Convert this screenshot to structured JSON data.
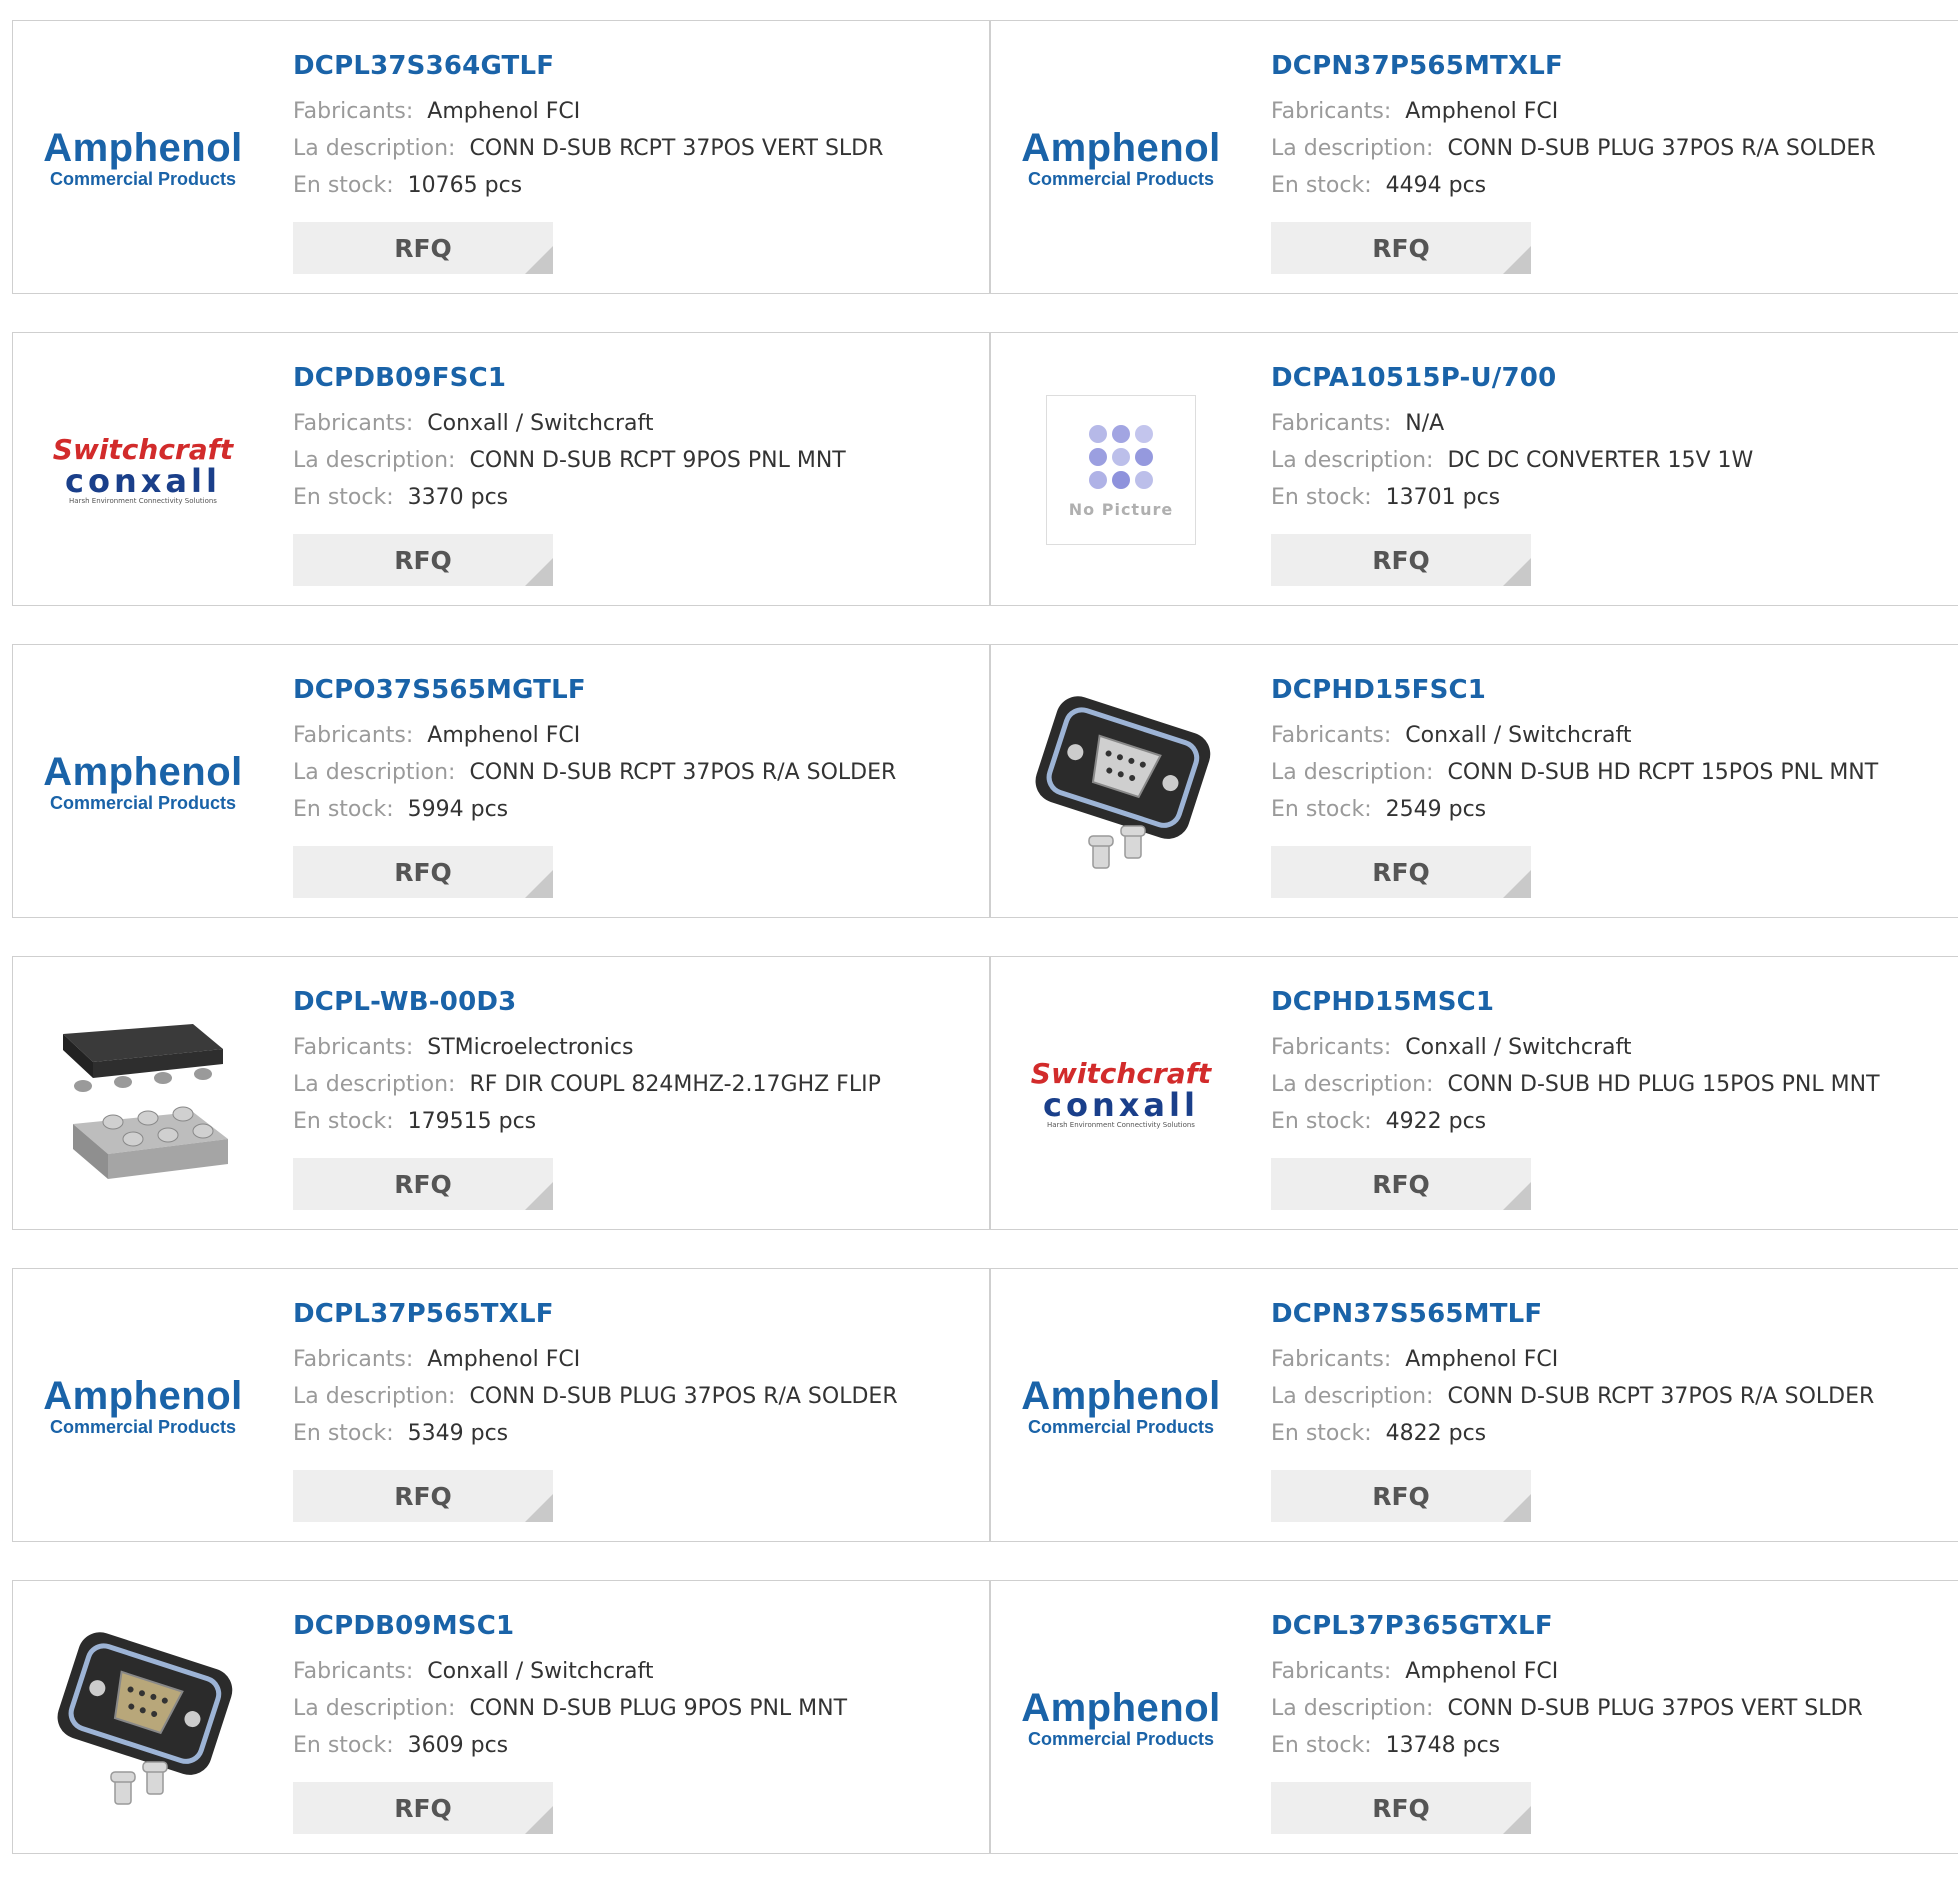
{
  "labels": {
    "manufacturer": "Fabricants:",
    "description": "La description:",
    "stock": "En stock:",
    "rfq": "RFQ"
  },
  "brand_color": "#1a63a8",
  "products": [
    {
      "part": "DCPL37S364GTLF",
      "manufacturer": "Amphenol FCI",
      "description": "CONN D-SUB RCPT 37POS VERT SLDR",
      "stock": "10765 pcs",
      "image": "amphenol-logo"
    },
    {
      "part": "DCPN37P565MTXLF",
      "manufacturer": "Amphenol FCI",
      "description": "CONN D-SUB PLUG 37POS R/A SOLDER",
      "stock": "4494 pcs",
      "image": "amphenol-logo"
    },
    {
      "part": "DCPDB09FSC1",
      "manufacturer": "Conxall / Switchcraft",
      "description": "CONN D-SUB RCPT 9POS PNL MNT",
      "stock": "3370 pcs",
      "image": "switchcraft-logo"
    },
    {
      "part": "DCPA10515P-U/700",
      "manufacturer": "N/A",
      "description": "DC DC CONVERTER 15V 1W",
      "stock": "13701 pcs",
      "image": "no-picture"
    },
    {
      "part": "DCPO37S565MGTLF",
      "manufacturer": "Amphenol FCI",
      "description": "CONN D-SUB RCPT 37POS R/A SOLDER",
      "stock": "5994 pcs",
      "image": "amphenol-logo"
    },
    {
      "part": "DCPHD15FSC1",
      "manufacturer": "Conxall / Switchcraft",
      "description": "CONN D-SUB HD RCPT 15POS PNL MNT",
      "stock": "2549 pcs",
      "image": "dsub-receptacle-photo"
    },
    {
      "part": "DCPL-WB-00D3",
      "manufacturer": "STMicroelectronics",
      "description": "RF DIR COUPL 824MHZ-2.17GHZ FLIP",
      "stock": "179515 pcs",
      "image": "flip-chip-photo"
    },
    {
      "part": "DCPHD15MSC1",
      "manufacturer": "Conxall / Switchcraft",
      "description": "CONN D-SUB HD PLUG 15POS PNL MNT",
      "stock": "4922 pcs",
      "image": "switchcraft-logo"
    },
    {
      "part": "DCPL37P565TXLF",
      "manufacturer": "Amphenol FCI",
      "description": "CONN D-SUB PLUG 37POS R/A SOLDER",
      "stock": "5349 pcs",
      "image": "amphenol-logo"
    },
    {
      "part": "DCPN37S565MTLF",
      "manufacturer": "Amphenol FCI",
      "description": "CONN D-SUB RCPT 37POS R/A SOLDER",
      "stock": "4822 pcs",
      "image": "amphenol-logo"
    },
    {
      "part": "DCPDB09MSC1",
      "manufacturer": "Conxall / Switchcraft",
      "description": "CONN D-SUB PLUG 9POS PNL MNT",
      "stock": "3609 pcs",
      "image": "dsub-plug-photo"
    },
    {
      "part": "DCPL37P365GTXLF",
      "manufacturer": "Amphenol FCI",
      "description": "CONN D-SUB PLUG 37POS VERT SLDR",
      "stock": "13748 pcs",
      "image": "amphenol-logo"
    }
  ],
  "logos": {
    "amphenol": {
      "line1": "Amphenol",
      "line2": "Commercial Products"
    },
    "switchcraft": {
      "line1": "Switchcraft",
      "line2": "conxall",
      "line3": "Harsh Environment Connectivity Solutions"
    },
    "no_picture": {
      "label": "No Picture"
    }
  }
}
